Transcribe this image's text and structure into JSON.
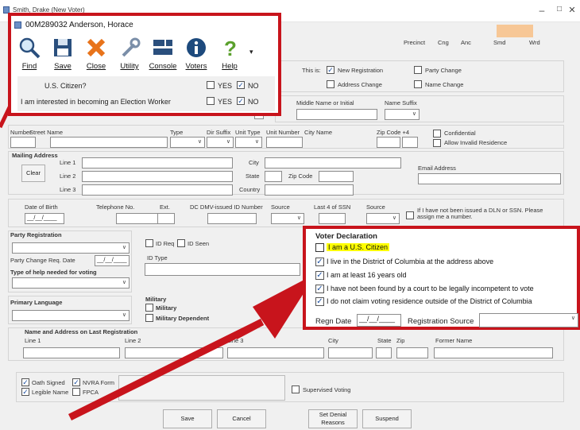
{
  "window": {
    "title": "Smith, Drake (New Voter)",
    "minimize_icon": "minimize-icon",
    "maximize_icon": "maximize-icon",
    "close_icon": "close-icon"
  },
  "header_codes": {
    "precinct": "Precinct",
    "cng": "Cng",
    "anc": "Anc",
    "smd": "Smd",
    "wrd": "Wrd",
    "anc_color": "#f7c796"
  },
  "popup": {
    "record": "00M289032 Anderson, Horace",
    "toolbar": [
      {
        "label": "Find",
        "icon": "search-icon"
      },
      {
        "label": "Save",
        "icon": "floppy-disk-icon"
      },
      {
        "label": "Close",
        "icon": "close-x-icon"
      },
      {
        "label": "Utility",
        "icon": "wrench-icon"
      },
      {
        "label": "Console",
        "icon": "console-icon"
      },
      {
        "label": "Voters",
        "icon": "info-icon"
      },
      {
        "label": "Help",
        "icon": "help-question-icon"
      }
    ],
    "citizen_q": "U.S. Citizen?",
    "worker_q": "I am interested in becoming an Election Worker",
    "yes": "YES",
    "no": "NO",
    "citizen_yes": false,
    "citizen_no": true,
    "worker_yes": false,
    "worker_no": true
  },
  "this_is": {
    "label": "This is:",
    "new_registration": "New Registration",
    "party_change": "Party Change",
    "address_change": "Address Change",
    "name_change": "Name Change",
    "new_registration_checked": true
  },
  "name": {
    "middle": "Middle Name or Initial",
    "suffix": "Name Suffix"
  },
  "residence": {
    "number": "Number",
    "street_name": "Street Name",
    "type": "Type",
    "dir_suffix": "Dir Suffix",
    "unit_type": "Unit Type",
    "unit_number": "Unit Number",
    "city_name": "City Name",
    "zip": "Zip Code +4",
    "confidential": "Confidential",
    "allow_invalid": "Allow Invalid Residence"
  },
  "mailing": {
    "title": "Mailing Address",
    "line1": "Line 1",
    "line2": "Line 2",
    "line3": "Line 3",
    "clear": "Clear",
    "city": "City",
    "state": "State",
    "zip": "Zip Code",
    "country": "Country",
    "email": "Email Address"
  },
  "ids": {
    "dob": "Date of Birth",
    "dob_value": "__/__/____",
    "phone": "Telephone No.",
    "ext": "Ext.",
    "dmv": "DC DMV-issued ID Number",
    "source": "Source",
    "ssn": "Last 4 of SSN",
    "source2": "Source",
    "no_dln": "If I have not been issued a DLN or SSN. Please assign me a number."
  },
  "party": {
    "title": "Party Registration",
    "change_date": "Party Change Req. Date",
    "change_date_value": "__/__/____",
    "help_title": "Type of help needed for voting",
    "lang_title": "Primary Language",
    "id_req": "ID Req",
    "id_seen": "ID Seen",
    "id_type": "ID Type",
    "military_title": "Military",
    "military": "Military",
    "military_dep": "Military Dependent"
  },
  "voter_declaration": {
    "title": "Voter Declaration",
    "items": [
      {
        "text": "I am a U.S. Citizen",
        "checked": false,
        "highlight": true
      },
      {
        "text": "I live in the District of Columbia at the address above",
        "checked": true,
        "highlight": false
      },
      {
        "text": "I am at least 16 years old",
        "checked": true,
        "highlight": false
      },
      {
        "text": "I have not been found by a court to be legally incompetent to vote",
        "checked": true,
        "highlight": false
      },
      {
        "text": "I do not claim voting residence outside of the District of Columbia",
        "checked": true,
        "highlight": false
      }
    ],
    "regn_date": "Regn Date",
    "regn_date_value": "__/__/____",
    "regn_source": "Registration Source",
    "highlight_color": "#ffff00"
  },
  "last_reg": {
    "title": "Name and Address on Last Registration",
    "line1": "Line 1",
    "line2": "Line 2",
    "line3": "Line 3",
    "city": "City",
    "state": "State",
    "zip": "Zip",
    "former_name": "Former Name"
  },
  "signature": {
    "oath": "Oath Signed",
    "nvra": "NVRA Form",
    "legible": "Legible Name",
    "fpca": "FPCA",
    "supervised": "Supervised Voting"
  },
  "buttons": {
    "save": "Save",
    "cancel": "Cancel",
    "set_denial": "Set Denial Reasons",
    "suspend": "Suspend"
  },
  "colors": {
    "annotation_red": "#c8141c"
  }
}
